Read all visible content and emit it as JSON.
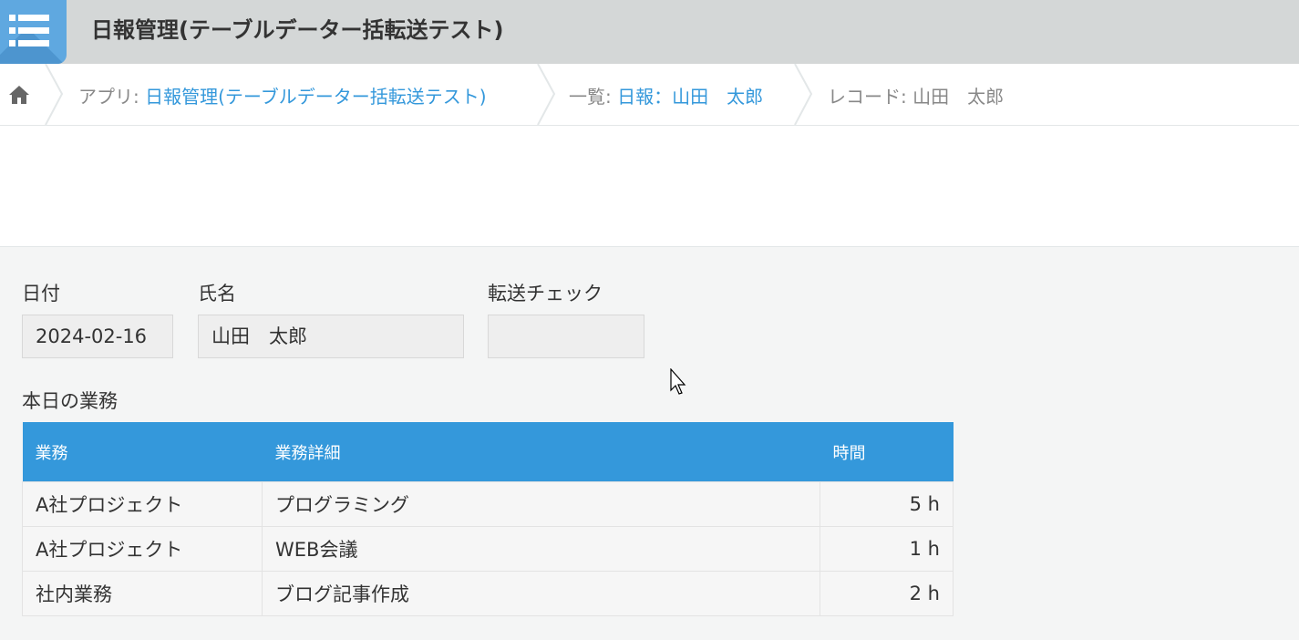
{
  "header": {
    "app_title": "日報管理(テーブルデーター括転送テスト)",
    "icon": "list-icon",
    "colors": {
      "bar": "#d4d7d7",
      "icon_bg": "#5fa8e0"
    }
  },
  "breadcrumb": {
    "home_icon": "home-icon",
    "app_prefix": "アプリ: ",
    "app_link": "日報管理(テーブルデーター括転送テスト)",
    "view_prefix": "一覧: ",
    "view_link": "日報：山田　太郎",
    "record_prefix": "レコード: ",
    "record_name": "山田　太郎"
  },
  "form": {
    "date_label": "日付",
    "date_value": "2024-02-16",
    "name_label": "氏名",
    "name_value": "山田　太郎",
    "transfer_label": "転送チェック",
    "transfer_value": ""
  },
  "tasks": {
    "label": "本日の業務",
    "headers": [
      "業務",
      "業務詳細",
      "時間"
    ],
    "rows": [
      [
        "A社プロジェクト",
        "プログラミング",
        "5 h"
      ],
      [
        "A社プロジェクト",
        "WEB会議",
        "1 h"
      ],
      [
        "社内業務",
        "ブログ記事作成",
        "2 h"
      ]
    ],
    "header_color": "#3498db"
  }
}
